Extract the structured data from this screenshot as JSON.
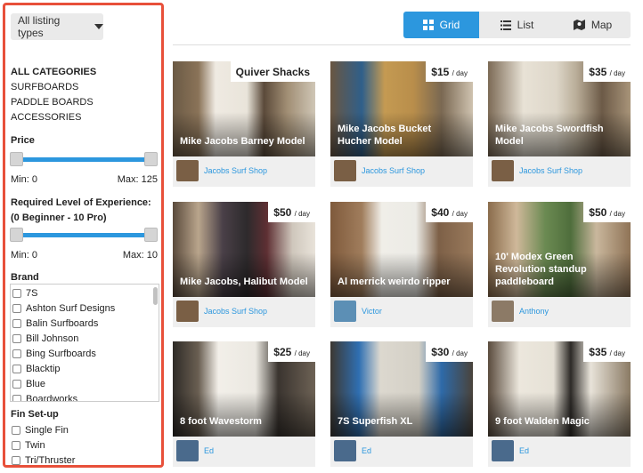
{
  "sidebar": {
    "listing_types_label": "All listing types",
    "categories_title": "ALL CATEGORIES",
    "categories": [
      "SURFBOARDS",
      "PADDLE BOARDS",
      "ACCESSORIES"
    ],
    "price_title": "Price",
    "price_min": "Min: 0",
    "price_max": "Max: 125",
    "price_range": [
      0,
      1
    ],
    "experience_title": "Required Level of Experience: (0 Beginner - 10 Pro)",
    "experience_min": "Min: 0",
    "experience_max": "Max: 10",
    "experience_range": [
      0,
      1
    ],
    "brand_title": "Brand",
    "brands": [
      "7S",
      "Ashton Surf Designs",
      "Balin Surfboards",
      "Bill Johnson",
      "Bing Surfboards",
      "Blacktip",
      "Blue",
      "Boardworks"
    ],
    "fin_title": "Fin Set-up",
    "fins": [
      "Single Fin",
      "Twin",
      "Tri/Thruster"
    ]
  },
  "view_toggle": {
    "grid": "Grid",
    "list": "List",
    "map": "Map",
    "active": "grid"
  },
  "colors": {
    "accent": "#2c97de",
    "highlight_border": "#e8503a"
  },
  "listings": [
    {
      "title": "Mike Jacobs Barney Model",
      "price_label": "Quiver Shacks",
      "per": "",
      "owner": "Jacobs Surf Shop"
    },
    {
      "title": "Mike Jacobs Bucket Hucher Model",
      "price_label": "$15",
      "per": "/ day",
      "owner": "Jacobs Surf Shop"
    },
    {
      "title": "Mike Jacobs Swordfish Model",
      "price_label": "$35",
      "per": "/ day",
      "owner": "Jacobs Surf Shop"
    },
    {
      "title": "Mike Jacobs, Halibut Model",
      "price_label": "$50",
      "per": "/ day",
      "owner": "Jacobs Surf Shop"
    },
    {
      "title": "Al merrick weirdo ripper",
      "price_label": "$40",
      "per": "/ day",
      "owner": "Victor"
    },
    {
      "title": "10' Modex Green Revolution standup paddleboard",
      "price_label": "$50",
      "per": "/ day",
      "owner": "Anthony"
    },
    {
      "title": "8 foot Wavestorm",
      "price_label": "$25",
      "per": "/ day",
      "owner": "Ed"
    },
    {
      "title": "7S Superfish XL",
      "price_label": "$30",
      "per": "/ day",
      "owner": "Ed"
    },
    {
      "title": "9 foot Walden Magic",
      "price_label": "$35",
      "per": "/ day",
      "owner": "Ed"
    }
  ]
}
